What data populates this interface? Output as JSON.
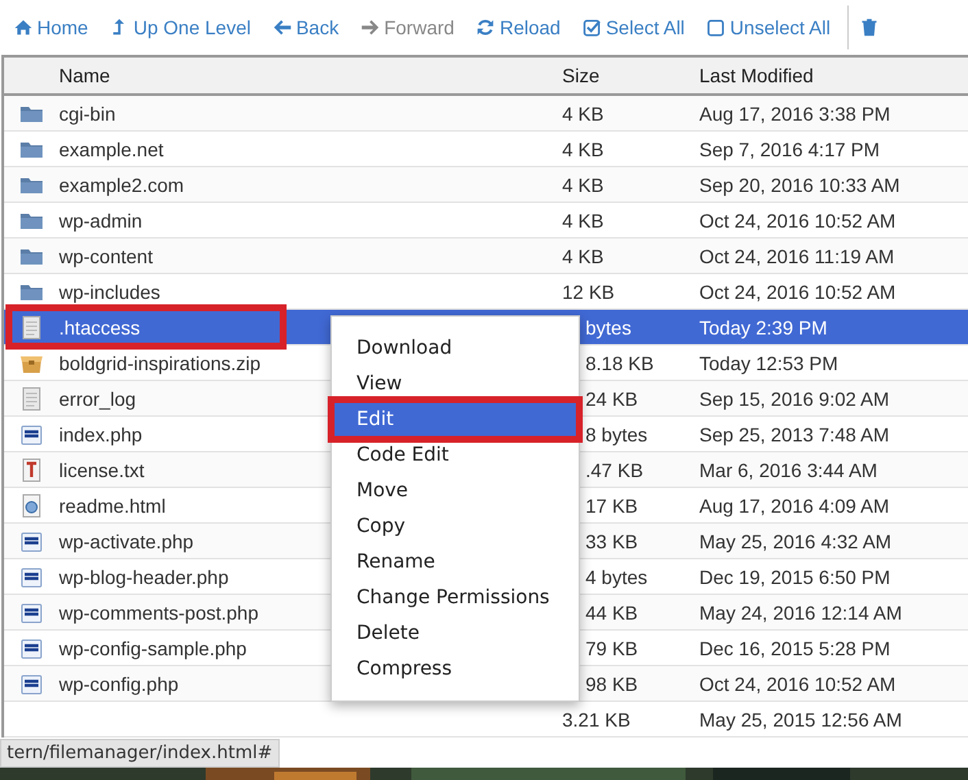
{
  "toolbar": [
    {
      "kind": "home",
      "label": "Home",
      "disabled": false
    },
    {
      "kind": "up",
      "label": "Up One Level",
      "disabled": false
    },
    {
      "kind": "back",
      "label": "Back",
      "disabled": false
    },
    {
      "kind": "forward",
      "label": "Forward",
      "disabled": true
    },
    {
      "kind": "reload",
      "label": "Reload",
      "disabled": false
    },
    {
      "kind": "select",
      "label": "Select All",
      "disabled": false
    },
    {
      "kind": "unselect",
      "label": "Unselect All",
      "disabled": false
    },
    {
      "kind": "trash"
    }
  ],
  "table": {
    "columns": [
      "Name",
      "Size",
      "Last Modified"
    ],
    "rows": [
      {
        "kind": "folder",
        "name": "cgi-bin",
        "size": "4 KB",
        "modified": "Aug 17, 2016 3:38 PM",
        "selected": false,
        "highlighted": false
      },
      {
        "kind": "folder",
        "name": "example.net",
        "size": "4 KB",
        "modified": "Sep 7, 2016 4:17 PM",
        "selected": false,
        "highlighted": false
      },
      {
        "kind": "folder",
        "name": "example2.com",
        "size": "4 KB",
        "modified": "Sep 20, 2016 10:33 AM",
        "selected": false,
        "highlighted": false
      },
      {
        "kind": "folder",
        "name": "wp-admin",
        "size": "4 KB",
        "modified": "Oct 24, 2016 10:52 AM",
        "selected": false,
        "highlighted": false
      },
      {
        "kind": "folder",
        "name": "wp-content",
        "size": "4 KB",
        "modified": "Oct 24, 2016 11:19 AM",
        "selected": false,
        "highlighted": false
      },
      {
        "kind": "folder",
        "name": "wp-includes",
        "size": "12 KB",
        "modified": "Oct 24, 2016 10:52 AM",
        "selected": false,
        "highlighted": false
      },
      {
        "kind": "file",
        "name": ".htaccess",
        "size": "bytes",
        "modified": "Today 2:39 PM",
        "selected": true,
        "highlighted": true
      },
      {
        "kind": "archive",
        "name": "boldgrid-inspirations.zip",
        "size": "8.18 KB",
        "modified": "Today 12:53 PM",
        "selected": false,
        "highlighted": false
      },
      {
        "kind": "file",
        "name": "error_log",
        "size": "24 KB",
        "modified": "Sep 15, 2016 9:02 AM",
        "selected": false,
        "highlighted": false
      },
      {
        "kind": "php",
        "name": "index.php",
        "size": "8 bytes",
        "modified": "Sep 25, 2013 7:48 AM",
        "selected": false,
        "highlighted": false
      },
      {
        "kind": "text",
        "name": "license.txt",
        "size": ".47 KB",
        "modified": "Mar 6, 2016 3:44 AM",
        "selected": false,
        "highlighted": false
      },
      {
        "kind": "html",
        "name": "readme.html",
        "size": "17 KB",
        "modified": "Aug 17, 2016 4:09 AM",
        "selected": false,
        "highlighted": false
      },
      {
        "kind": "php",
        "name": "wp-activate.php",
        "size": "33 KB",
        "modified": "May 25, 2016 4:32 AM",
        "selected": false,
        "highlighted": false
      },
      {
        "kind": "php",
        "name": "wp-blog-header.php",
        "size": "4 bytes",
        "modified": "Dec 19, 2015 6:50 PM",
        "selected": false,
        "highlighted": false
      },
      {
        "kind": "php",
        "name": "wp-comments-post.php",
        "size": "44 KB",
        "modified": "May 24, 2016 12:14 AM",
        "selected": false,
        "highlighted": false
      },
      {
        "kind": "php",
        "name": "wp-config-sample.php",
        "size": "79 KB",
        "modified": "Dec 16, 2015 5:28 PM",
        "selected": false,
        "highlighted": false
      },
      {
        "kind": "php",
        "name": "wp-config.php",
        "size": "98 KB",
        "modified": "Oct 24, 2016 10:52 AM",
        "selected": false,
        "highlighted": false
      },
      {
        "size": "3.21 KB",
        "modified": "May 25, 2015 12:56 AM",
        "selected": false,
        "highlighted": false
      }
    ]
  },
  "context_menu": {
    "items": [
      {
        "label": "Download",
        "selected": false,
        "highlighted": false
      },
      {
        "label": "View",
        "selected": false,
        "highlighted": false
      },
      {
        "label": "Edit",
        "selected": true,
        "highlighted": true
      },
      {
        "label": "Code Edit",
        "selected": false,
        "highlighted": false
      },
      {
        "label": "Move",
        "selected": false,
        "highlighted": false
      },
      {
        "label": "Copy",
        "selected": false,
        "highlighted": false
      },
      {
        "label": "Rename",
        "selected": false,
        "highlighted": false
      },
      {
        "label": "Change Permissions",
        "selected": false,
        "highlighted": false
      },
      {
        "label": "Delete",
        "selected": false,
        "highlighted": false
      },
      {
        "label": "Compress",
        "selected": false,
        "highlighted": false
      }
    ]
  },
  "status_link": "tern/filemanager/index.html#"
}
